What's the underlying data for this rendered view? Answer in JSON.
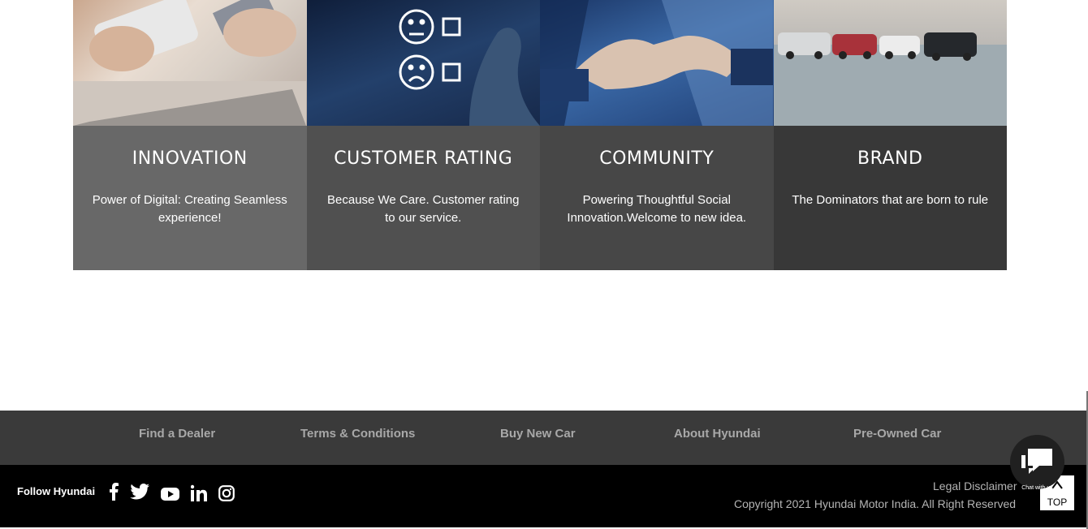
{
  "cards": [
    {
      "title": "INNOVATION",
      "description": "Power of Digital: Creating Seamless experience!",
      "image": "phone-payment-photo"
    },
    {
      "title": "CUSTOMER RATING",
      "description": "Because We Care. Customer rating to our service.",
      "image": "rating-faces-photo"
    },
    {
      "title": "COMMUNITY",
      "description": "Powering Thoughtful Social Innovation.Welcome to new idea.",
      "image": "handshake-photo"
    },
    {
      "title": "BRAND",
      "description": "The Dominators that are born to rule",
      "image": "suv-lineup-photo"
    }
  ],
  "footer_nav": {
    "links": [
      "Find a Dealer",
      "Terms & Conditions",
      "Buy New Car",
      "About Hyundai",
      "Pre-Owned Car"
    ]
  },
  "footer": {
    "follow_label": "Follow Hyundai",
    "social_icons": [
      "facebook-icon",
      "twitter-icon",
      "youtube-icon",
      "linkedin-icon",
      "instagram-icon"
    ],
    "legal_label": "Legal Disclaimer",
    "copyright": "Copyright 2021 Hyundai Motor India. All Right Reserved"
  },
  "chat": {
    "label": "Chat with us"
  },
  "top_button": {
    "label": "TOP"
  },
  "colors": {
    "card1": "#686868",
    "card2": "#505050",
    "card3": "#474747",
    "card4": "#383838",
    "footer_nav_bg": "#3a3a3a",
    "footer_bg": "#000000",
    "link_color": "#a8a8a8"
  }
}
